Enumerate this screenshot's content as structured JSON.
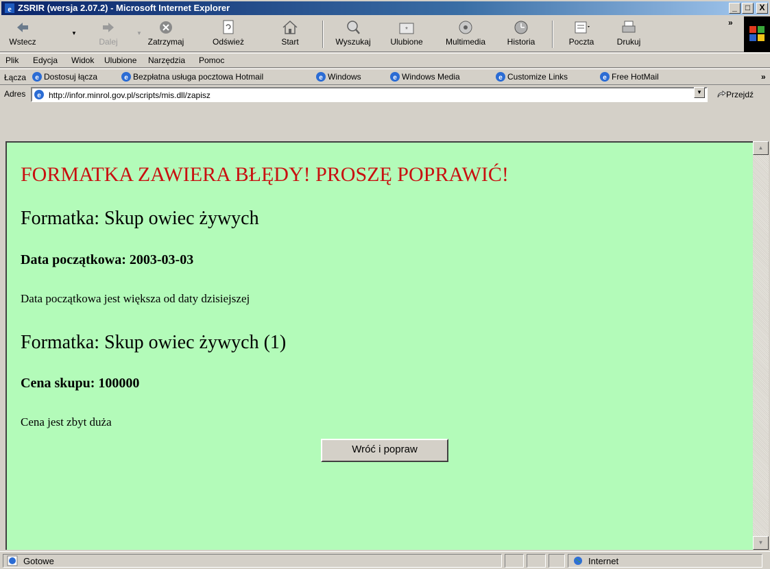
{
  "window": {
    "title": "ZSRIR (wersja 2.07.2) - Microsoft Internet Explorer",
    "minimize_glyph": "_",
    "maximize_glyph": "□",
    "close_glyph": "X"
  },
  "toolbar": {
    "back": "Wstecz",
    "forward": "Dalej",
    "stop": "Zatrzymaj",
    "refresh": "Odśwież",
    "home": "Start",
    "search": "Wyszukaj",
    "favorites": "Ulubione",
    "media": "Multimedia",
    "history": "Historia",
    "mail": "Poczta",
    "print": "Drukuj",
    "more": "»"
  },
  "menu": {
    "file": "Plik",
    "edit": "Edycja",
    "view": "Widok",
    "favorites": "Ulubione",
    "tools": "Narzędzia",
    "help": "Pomoc"
  },
  "links": {
    "label": "Łącza",
    "items": [
      "Dostosuj łącza",
      "Bezpłatna usługa pocztowa Hotmail",
      "Windows",
      "Windows Media",
      "Customize Links",
      "Free HotMail"
    ],
    "more": "»"
  },
  "address": {
    "label": "Adres",
    "url": "http://infor.minrol.gov.pl/scripts/mis.dll/zapisz",
    "go": "Przejdź"
  },
  "page": {
    "error_heading": "FORMATKA ZAWIERA BŁĘDY! PROSZĘ POPRAWIĆ!",
    "form1_title": "Formatka: Skup owiec żywych",
    "field1_label": "Data początkowa: 2003-03-03",
    "field1_error": "Data początkowa jest większa od daty dzisiejszej",
    "form2_title": "Formatka: Skup owiec żywych (1)",
    "field2_label": "Cena skupu: 100000",
    "field2_error": "Cena jest zbyt duża",
    "back_button": "Wróć i popraw"
  },
  "status": {
    "text": "Gotowe",
    "zone": "Internet"
  },
  "colors": {
    "page_background": "#b3fbb9",
    "error_heading": "#c81010",
    "titlebar": "#0a246a"
  },
  "icons": {
    "app": "ie-icon",
    "back": "arrow-left-icon",
    "forward": "arrow-right-icon",
    "stop": "stop-icon",
    "refresh": "refresh-icon",
    "home": "home-icon",
    "search": "search-icon",
    "favorites": "favorites-icon",
    "media": "media-icon",
    "history": "history-icon",
    "mail": "mail-icon",
    "print": "print-icon",
    "go": "go-arrow-icon",
    "zone": "internet-globe-icon"
  }
}
